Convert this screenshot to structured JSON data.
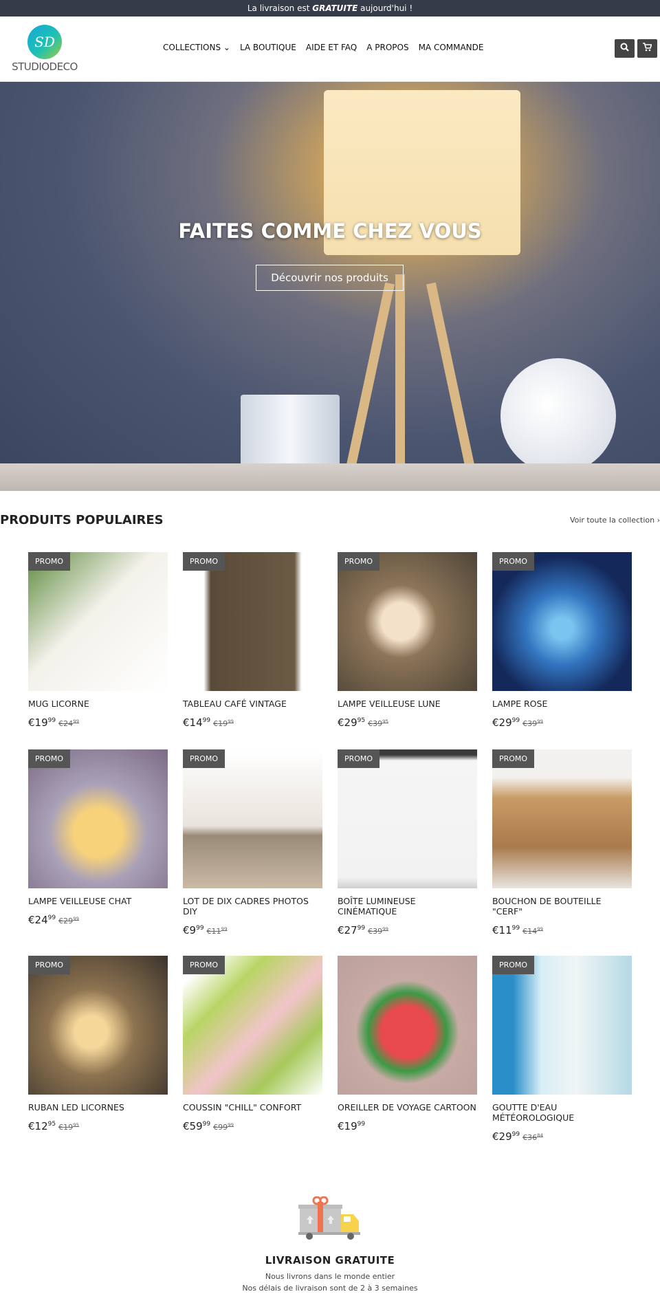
{
  "announcement": {
    "prefix": "La livraison est ",
    "emphasis": "GRATUITE",
    "suffix": " aujourd'hui !"
  },
  "header": {
    "logo_mark": "SD",
    "logo_text": "STUDIODECO",
    "nav": [
      {
        "label": "COLLECTIONS ⌄"
      },
      {
        "label": "LA BOUTIQUE"
      },
      {
        "label": "AIDE ET FAQ"
      },
      {
        "label": "A PROPOS"
      },
      {
        "label": "MA COMMANDE"
      }
    ],
    "search_icon": "⌕",
    "cart_icon": "🛒"
  },
  "hero": {
    "title": "FAITES COMME CHEZ VOUS",
    "button": "Découvrir nos produits"
  },
  "popular": {
    "title": "PRODUITS POPULAIRES",
    "link": "Voir toute la collection ›",
    "badge": "PROMO",
    "products": [
      {
        "title": "MUG LICORNE",
        "price": "€19",
        "cents": "99",
        "old": "€24",
        "old_cents": "99",
        "promo": true,
        "color": "linear-gradient(135deg,#5d8a3e,#f3f1ea 45%,#fff)"
      },
      {
        "title": "TABLEAU CAFÉ VINTAGE",
        "price": "€14",
        "cents": "99",
        "old": "€19",
        "old_cents": "99",
        "promo": true,
        "color": "linear-gradient(90deg,#fff 15%,#5a4a38 20%,#6b5a44 80%,#fff 85%)"
      },
      {
        "title": "LAMPE VEILLEUSE LUNE",
        "price": "€29",
        "cents": "95",
        "old": "€39",
        "old_cents": "95",
        "promo": true,
        "color": "radial-gradient(circle at 45% 50%,#f3e1c9 18%,#8d7558 35%,#4e4538)"
      },
      {
        "title": "LAMPE ROSE",
        "price": "€29",
        "cents": "99",
        "old": "€39",
        "old_cents": "99",
        "promo": true,
        "color": "radial-gradient(circle at 50% 55%,#7ac5f0 10%,#3375c0 35%,#14285a 70%)"
      },
      {
        "title": "LAMPE VEILLEUSE CHAT",
        "price": "€24",
        "cents": "99",
        "old": "€29",
        "old_cents": "99",
        "promo": true,
        "color": "radial-gradient(circle at 50% 60%,#f8d27a 22%,#a9a1b7 45%,#7c6a86)"
      },
      {
        "title": "LOT DE DIX CADRES PHOTOS DIY",
        "price": "€9",
        "cents": "99",
        "old": "€11",
        "old_cents": "99",
        "promo": true,
        "color": "linear-gradient(#fff 0,#e8e3dc 55%,#9a8b79 62%,#c9b9a5)"
      },
      {
        "title": "BOÎTE LUMINEUSE CINÉMATIQUE",
        "price": "€27",
        "cents": "99",
        "old": "€39",
        "old_cents": "99",
        "promo": true,
        "color": "linear-gradient(#3b3b3b 4%,#f5f5f5 8%,#f2f2f2 92%,#cfcfcf)"
      },
      {
        "title": "BOUCHON DE BOUTEILLE \"CERF\"",
        "price": "€11",
        "cents": "99",
        "old": "€14",
        "old_cents": "99",
        "promo": true,
        "color": "linear-gradient(#f3f1ef 20%,#c89b66 35%,#a97a4c 70%,#e8e4df)"
      },
      {
        "title": "RUBAN LED LICORNES",
        "price": "€12",
        "cents": "95",
        "old": "€19",
        "old_cents": "95",
        "promo": true,
        "color": "radial-gradient(circle at 45% 55%,#f5d79a 15%,#8d7350 40%,#3a332c)"
      },
      {
        "title": "COUSSIN \"CHILL\" CONFORT",
        "price": "€59",
        "cents": "99",
        "old": "€99",
        "old_cents": "99",
        "promo": true,
        "color": "linear-gradient(135deg,#fff 10%,#b9d565 30%,#f2c4c9 55%,#a5c95a 75%,#fff)"
      },
      {
        "title": "OREILLER DE VOYAGE CARTOON",
        "price": "€19",
        "cents": "99",
        "old": "",
        "old_cents": "",
        "promo": false,
        "color": "radial-gradient(circle at 50% 55%,#e84a4f 25%,#3c9a45 38%,#c8aaa5 50%,#bba09b)"
      },
      {
        "title": "GOUTTE D'EAU MÉTÉOROLOGIQUE",
        "price": "€29",
        "cents": "99",
        "old": "€36",
        "old_cents": "84",
        "promo": true,
        "color": "linear-gradient(90deg,#2a8fc8 15%,#d8eef5 35%,#f0f5f5 60%,#b5d9e6)"
      }
    ]
  },
  "feature": {
    "title": "LIVRAISON GRATUITE",
    "lines": [
      "Nous livrons dans le monde entier",
      "Nos délais de livraison sont de 2 à 3 semaines"
    ]
  },
  "colors": {
    "topbar": "#363b48",
    "badge": "#555555"
  }
}
